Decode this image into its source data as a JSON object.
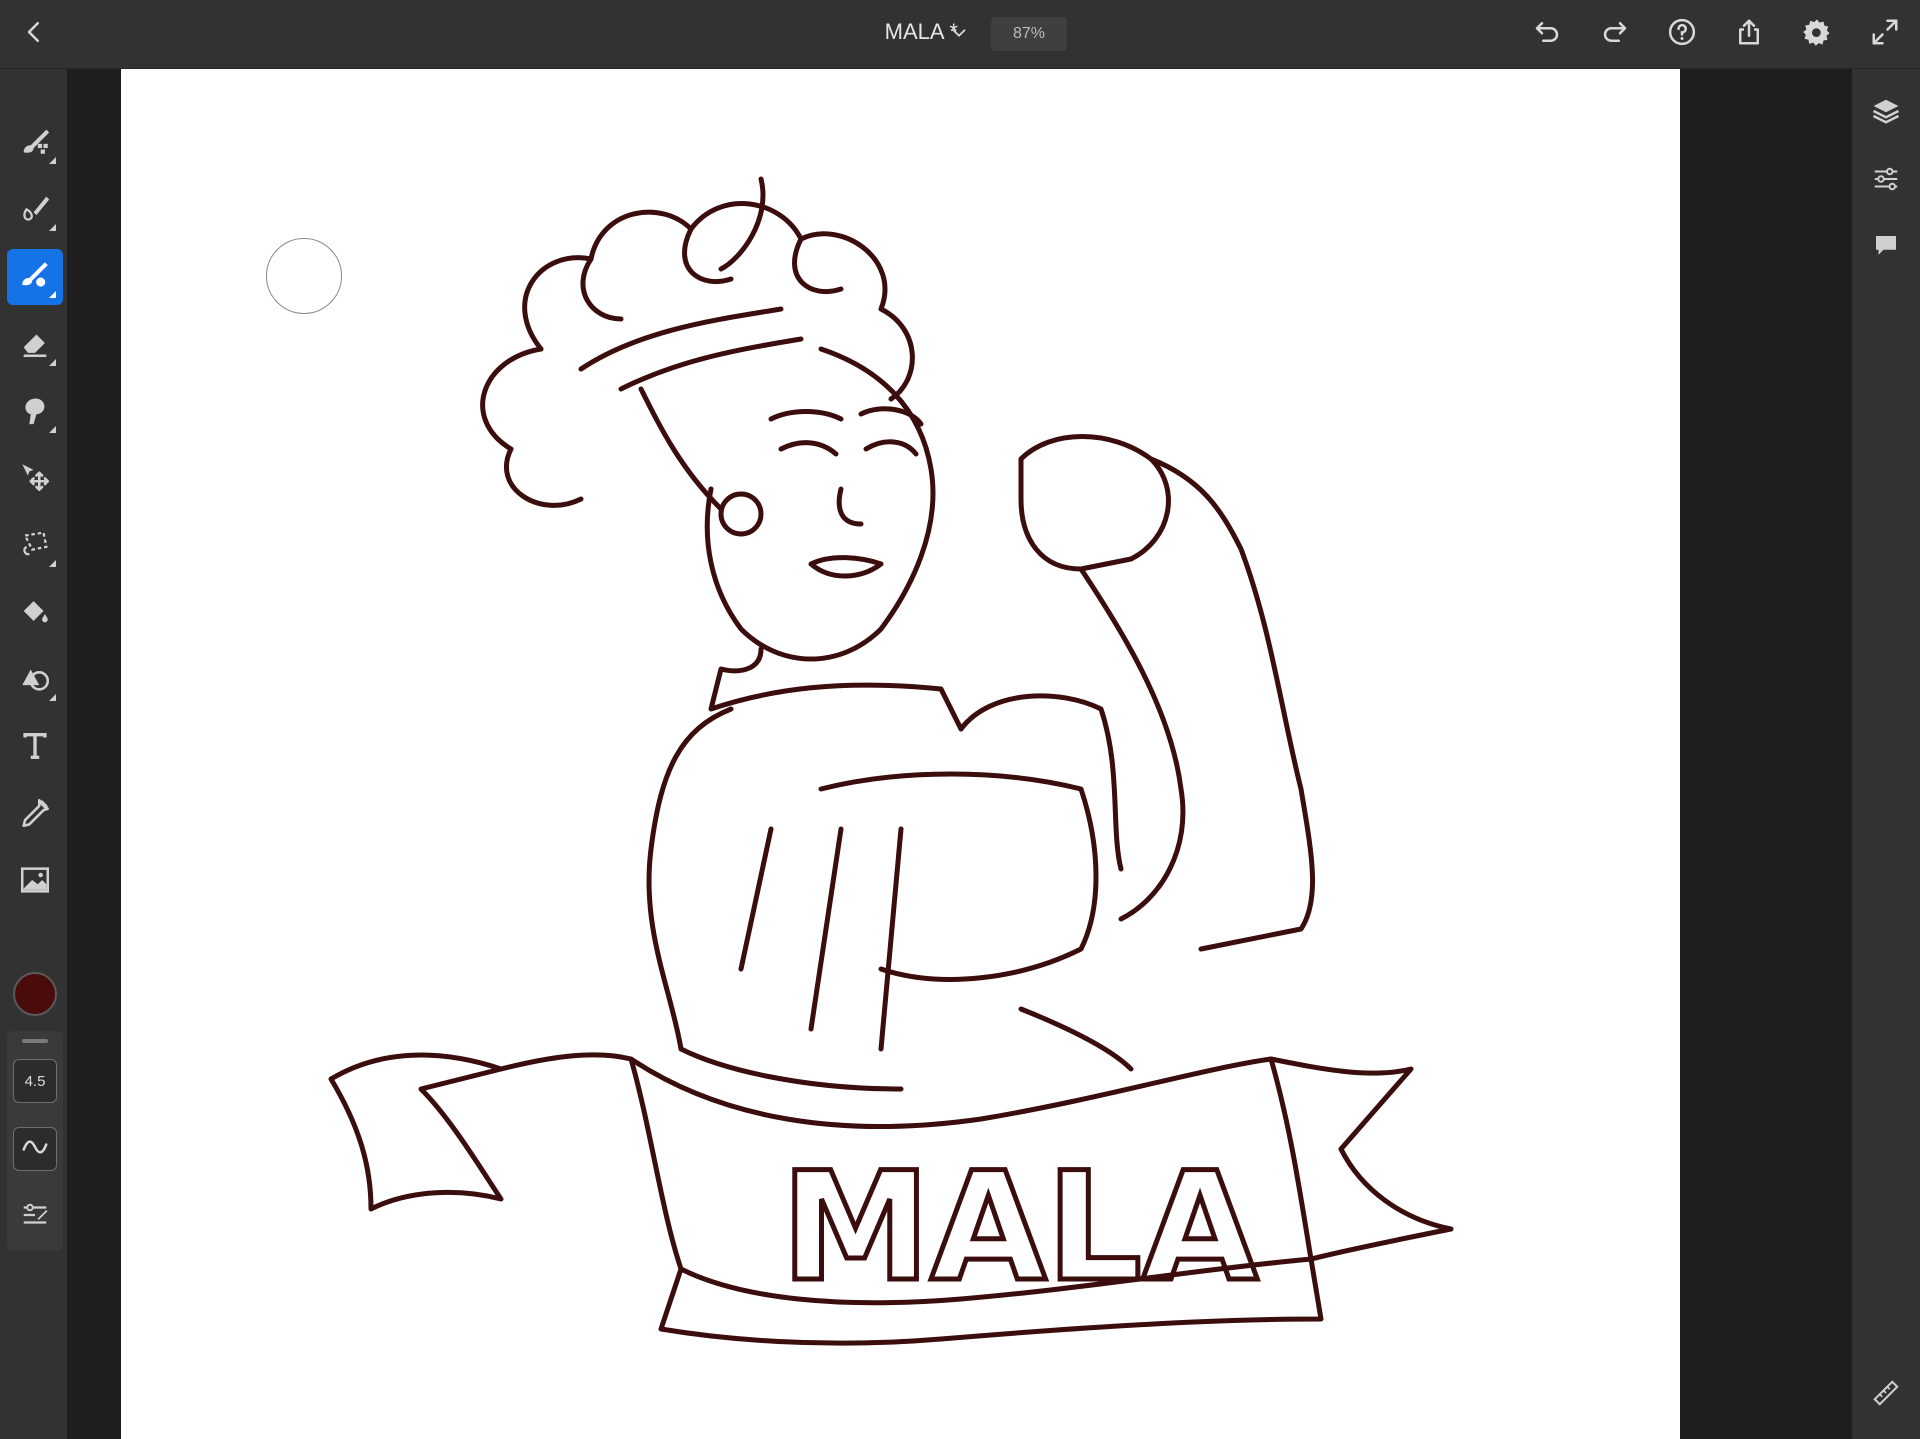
{
  "document": {
    "title": "MALA *",
    "zoom": "87%"
  },
  "topbar": {
    "back_icon": "chevron-left-icon",
    "title_menu_icon": "chevron-down-icon",
    "actions": [
      "undo-icon",
      "redo-icon",
      "help-icon",
      "share-icon",
      "settings-icon",
      "fullscreen-icon"
    ]
  },
  "toolbar": {
    "tools": [
      "pixel-brush-icon",
      "live-brush-icon",
      "vector-brush-icon",
      "eraser-icon",
      "smudge-icon",
      "move-icon",
      "lasso-icon",
      "fill-icon",
      "shapes-icon",
      "text-icon",
      "eyedropper-icon",
      "image-icon"
    ],
    "active_tool": "vector-brush-icon",
    "color": "#4a0b0b"
  },
  "brush_panel": {
    "size": "4.5"
  },
  "rightbar": {
    "tools": [
      "layers-icon",
      "properties-icon",
      "comments-icon",
      "ruler-icon"
    ]
  },
  "canvas": {
    "artwork_text": "MALA",
    "line_color": "#3b0d0d"
  }
}
